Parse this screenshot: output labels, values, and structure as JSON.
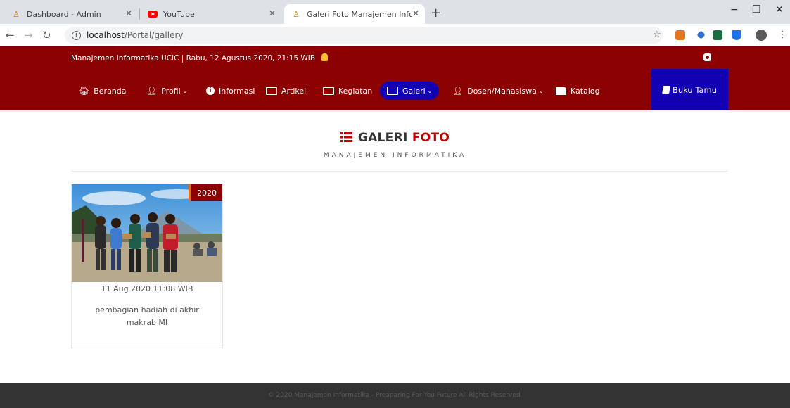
{
  "browser": {
    "tabs": [
      {
        "title": "Dashboard - Admin",
        "icon": "site-logo-icon",
        "active": false
      },
      {
        "title": "YouTube",
        "icon": "youtube-icon",
        "active": false
      },
      {
        "title": "Galeri Foto Manajemen Informati",
        "icon": "site-logo-icon",
        "active": true
      }
    ],
    "url_host": "localhost",
    "url_path": "/Portal/gallery"
  },
  "header": {
    "info_text": "Manajemen Informatika UCIC | Rabu, 12 Agustus 2020, 21:15 WIB",
    "menu": [
      {
        "label": "Beranda",
        "icon": "home-icon"
      },
      {
        "label": "Profil",
        "icon": "user-icon",
        "dropdown": true
      },
      {
        "label": "Informasi",
        "icon": "info-icon"
      },
      {
        "label": "Artikel",
        "icon": "newspaper-icon"
      },
      {
        "label": "Kegiatan",
        "icon": "newspaper-icon"
      },
      {
        "label": "Galeri",
        "icon": "image-icon",
        "dropdown": true,
        "active": true
      },
      {
        "label": "Dosen/Mahasiswa",
        "icon": "user-icon",
        "dropdown": true
      },
      {
        "label": "Katalog",
        "icon": "folder-icon"
      }
    ],
    "guestbook_label": "Buku Tamu"
  },
  "page": {
    "title_main": "GALERI",
    "title_accent": "FOTO",
    "subtitle": "MANAJEMEN INFORMATIKA"
  },
  "gallery": [
    {
      "year": "2020",
      "date": "11 Aug 2020 11:08 WIB",
      "caption": "pembagian hadiah di akhir makrab MI"
    }
  ],
  "footer": {
    "text": "© 2020 Manajemen Informatika - Preaparing For You Future All Rights Reserved."
  },
  "colors": {
    "brand_red": "#8b0000",
    "active_blue": "#1400b3",
    "footer_bg": "#333333"
  }
}
